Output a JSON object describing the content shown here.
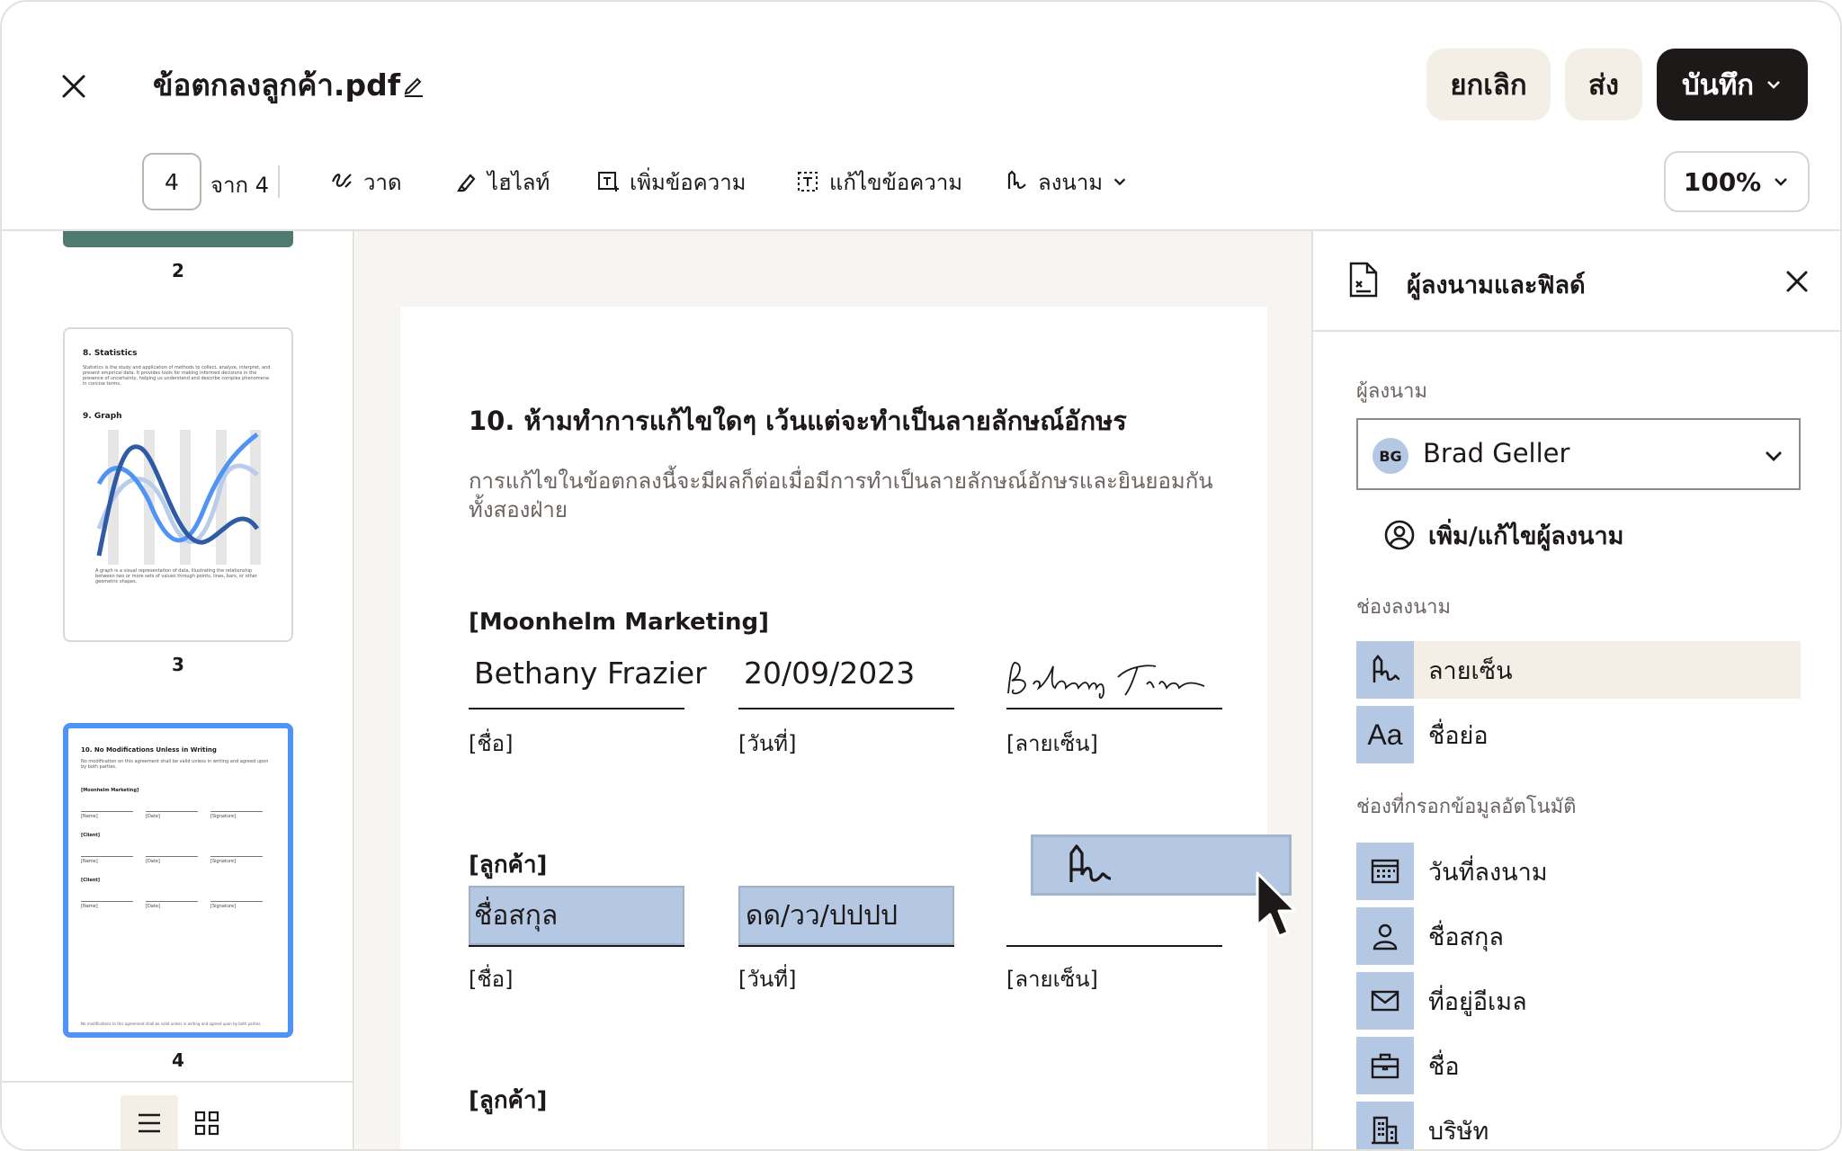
{
  "header": {
    "document_title": "ข้อตกลงลูกค้า.pdf",
    "cancel_label": "ยกเลิก",
    "send_label": "ส่ง",
    "save_label": "บันทึก"
  },
  "toolbar": {
    "current_page": "4",
    "page_of": "จาก 4",
    "tools": [
      {
        "label": "วาด",
        "icon": "draw-icon"
      },
      {
        "label": "ไฮไลท์",
        "icon": "highlighter-icon"
      },
      {
        "label": "เพิ่มข้อความ",
        "icon": "add-text-icon"
      },
      {
        "label": "แก้ไขข้อความ",
        "icon": "edit-text-icon"
      },
      {
        "label": "ลงนาม",
        "icon": "sign-icon"
      }
    ],
    "zoom": "100%"
  },
  "thumbnails": {
    "pages": [
      "2",
      "3",
      "4"
    ],
    "page3": {
      "heading1": "8. Statistics",
      "body1": "Statistics is the study and application of methods to collect, analyze, interpret, and present empirical data. It provides tools for making informed decisions in the presence of uncertainty, helping us understand and describe complex phenomena in concise terms.",
      "heading2": "9. Graph",
      "body2": "A graph is a visual representation of data, illustrating the relationship between two or more sets of values through points, lines, bars, or other geometric shapes."
    },
    "page4": {
      "heading": "10. No Modifications Unless in Writing",
      "body": "No modification on this agreement shall be valid unless in writing and agreed upon by both parties.",
      "party1": "[Moonhelm Marketing]",
      "party2": "[Client]",
      "party3": "[Client]",
      "name_label": "[Name]",
      "date_label": "[Date]",
      "signature_label": "[Signature]",
      "footer": "No modifications to this agreement shall be valid unless in writing and agreed upon by both parties."
    }
  },
  "document": {
    "section_title": "10. ห้ามทำการแก้ไขใดๆ เว้นแต่จะทำเป็นลายลักษณ์อักษร",
    "section_body": "การแก้ไขในข้อตกลงนี้จะมีผลก็ต่อเมื่อมีการทำเป็นลายลักษณ์อักษรและยินยอมกันทั้งสองฝ่าย",
    "party1": "[Moonhelm Marketing]",
    "party1_name": "Bethany Frazier",
    "party1_date": "20/09/2023",
    "party2": "[ลูกค้า]",
    "party3": "[ลูกค้า]",
    "name_label": "[ชื่อ]",
    "date_label": "[วันที่]",
    "signature_label": "[ลายเซ็น]",
    "name_placeholder": "ชื่อสกุล",
    "date_placeholder": "ดด/วว/ปปปป"
  },
  "panel": {
    "title": "ผู้ลงนามและฟิลด์",
    "signer_section": "ผู้ลงนาม",
    "signer_initials": "BG",
    "signer_name": "Brad Geller",
    "add_signer": "เพิ่ม/แก้ไขผู้ลงนาม",
    "signature_fields_section": "ช่องลงนาม",
    "signature_fields": [
      {
        "label": "ลายเซ็น",
        "icon": "signature-icon"
      },
      {
        "label": "ชื่อย่อ",
        "icon": "initials-icon"
      }
    ],
    "autofill_section": "ช่องที่กรอกข้อมูลอัตโนมัติ",
    "autofill_fields": [
      {
        "label": "วันที่ลงนาม",
        "icon": "calendar-icon"
      },
      {
        "label": "ชื่อสกุล",
        "icon": "person-icon"
      },
      {
        "label": "ที่อยู่อีเมล",
        "icon": "mail-icon"
      },
      {
        "label": "ชื่อ",
        "icon": "briefcase-icon"
      },
      {
        "label": "บริษัท",
        "icon": "building-icon"
      }
    ]
  },
  "colors": {
    "accent_field": "#b4c8e4",
    "active_thumb": "#4f93f5",
    "primary_button": "#1e1919",
    "secondary_button": "#f3efe6"
  }
}
